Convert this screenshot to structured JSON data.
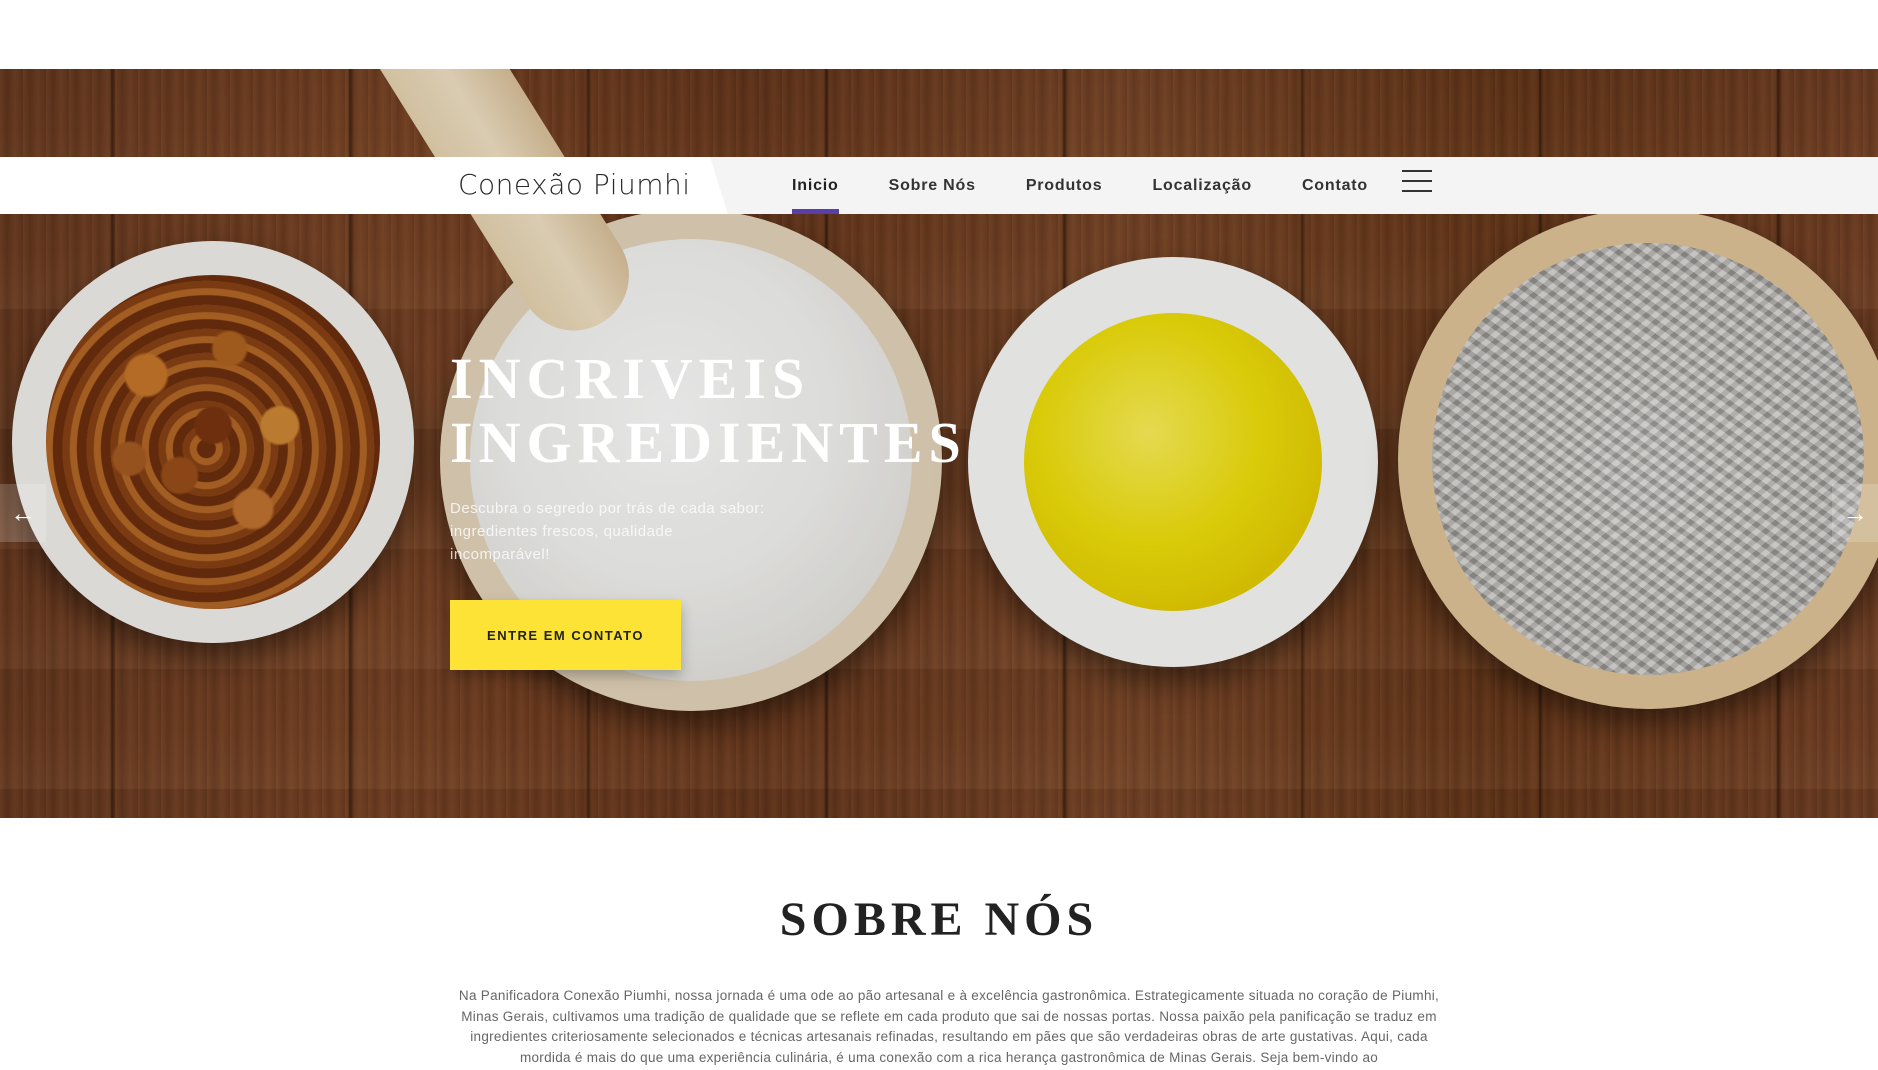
{
  "header": {
    "brand": "Conexão Piumhi",
    "nav_items": [
      {
        "label": "Inicio",
        "active": true
      },
      {
        "label": "Sobre Nós",
        "active": false
      },
      {
        "label": "Produtos",
        "active": false
      },
      {
        "label": "Localização",
        "active": false
      },
      {
        "label": "Contato",
        "active": false
      }
    ],
    "menu_icon": "hamburger-menu-icon",
    "accent_color": "#5a3fa8"
  },
  "hero": {
    "title": "Incriveis Ingredientes",
    "subtitle": "Descubra o segredo por trás de cada sabor: ingredientes frescos, qualidade incomparável!",
    "cta_label": "ENTRE EM CONTATO",
    "cta_color": "#fce336",
    "prev_icon": "arrow-left-icon",
    "next_icon": "arrow-right-icon"
  },
  "about": {
    "title": "SOBRE NÓS",
    "text": "Na Panificadora Conexão Piumhi, nossa jornada é uma ode ao pão artesanal e à excelência gastronômica. Estrategicamente situada no coração de Piumhi, Minas Gerais, cultivamos uma tradição de qualidade que se reflete em cada produto que sai de nossas portas. Nossa paixão pela panificação se traduz em ingredientes criteriosamente selecionados e técnicas artesanais refinadas, resultando em pães que são verdadeiras obras de arte gustativas. Aqui, cada mordida é mais do que uma experiência culinária, é uma conexão com a rica herança gastronômica de Minas Gerais. Seja bem-vindo ao"
  }
}
